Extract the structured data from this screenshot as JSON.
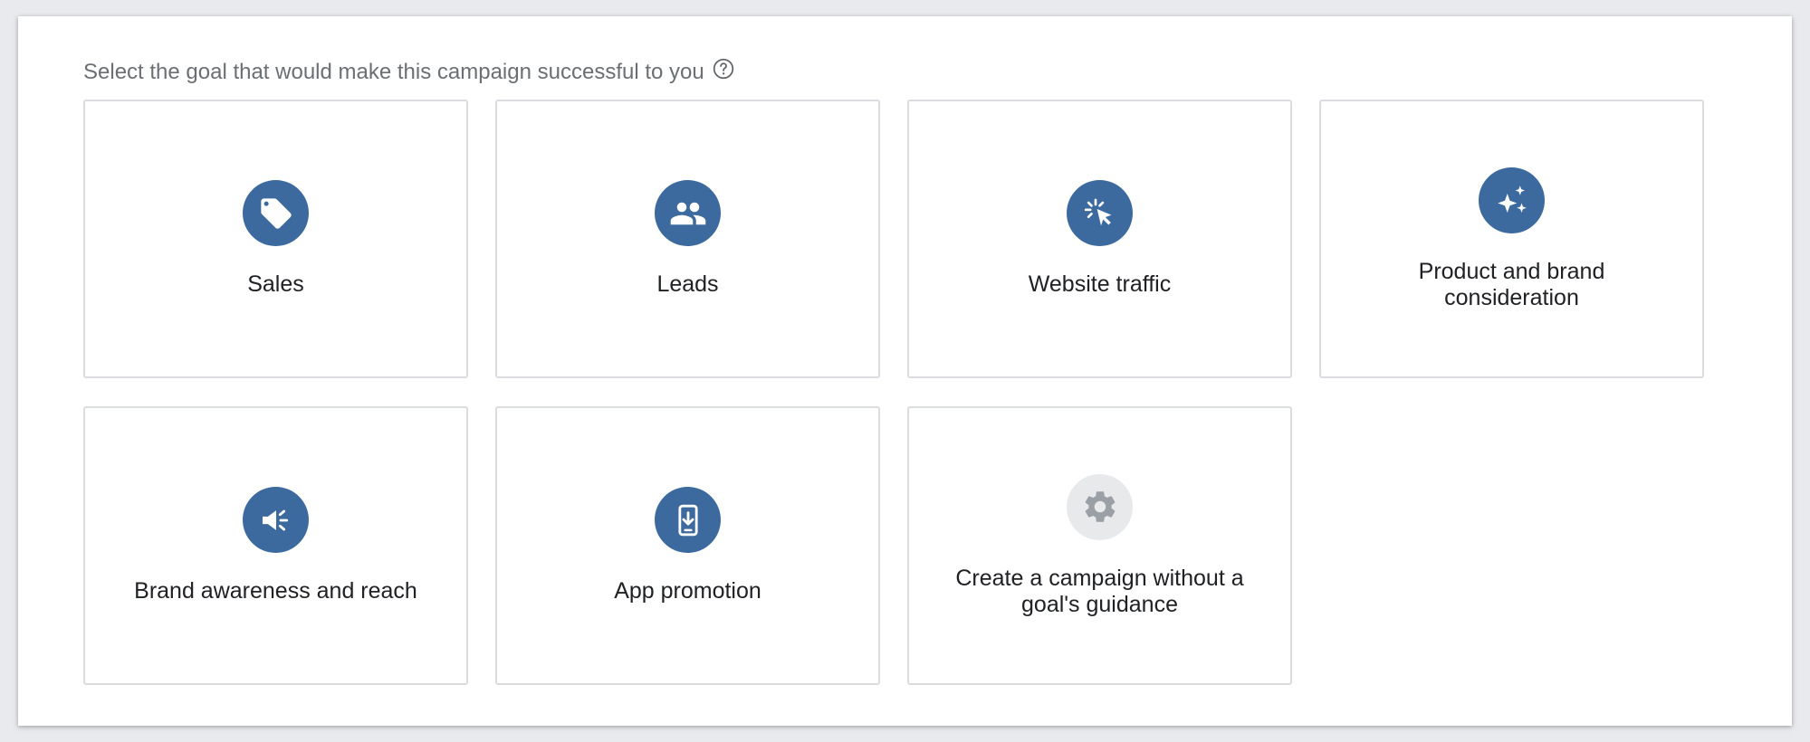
{
  "prompt": {
    "text": "Select the goal that would make this campaign successful to you",
    "help_icon": "help-circle-icon"
  },
  "goals": [
    {
      "label": "Sales",
      "icon": "tag-icon"
    },
    {
      "label": "Leads",
      "icon": "people-icon"
    },
    {
      "label": "Website traffic",
      "icon": "cursor-click-icon"
    },
    {
      "label": "Product and brand consideration",
      "icon": "sparkle-icon"
    },
    {
      "label": "Brand awareness and reach",
      "icon": "megaphone-icon"
    },
    {
      "label": "App promotion",
      "icon": "phone-download-icon"
    },
    {
      "label": "Create a campaign without a goal's guidance",
      "icon": "gear-icon"
    }
  ],
  "colors": {
    "icon_bg": "#3d6a9e",
    "icon_bg_neutral": "#e8e9eb",
    "border": "#dadce0",
    "prompt_text": "#6b6f73"
  }
}
